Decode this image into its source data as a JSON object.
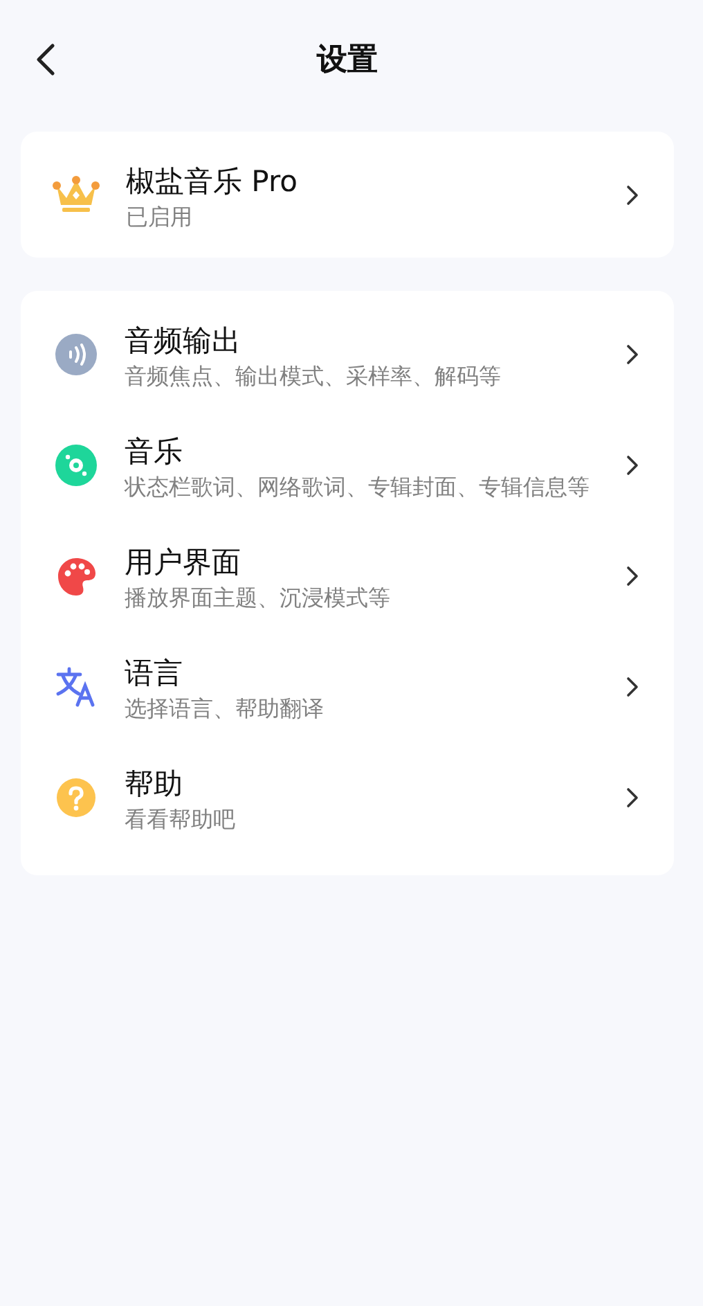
{
  "header": {
    "title": "设置"
  },
  "pro": {
    "title": "椒盐音乐 Pro",
    "subtitle": "已启用"
  },
  "items": [
    {
      "kind": "audio",
      "title": "音频输出",
      "subtitle": "音频焦点、输出模式、采样率、解码等"
    },
    {
      "kind": "music",
      "title": "音乐",
      "subtitle": "状态栏歌词、网络歌词、专辑封面、专辑信息等"
    },
    {
      "kind": "palette",
      "title": "用户界面",
      "subtitle": "播放界面主题、沉浸模式等"
    },
    {
      "kind": "translate",
      "title": "语言",
      "subtitle": "选择语言、帮助翻译"
    },
    {
      "kind": "help",
      "title": "帮助",
      "subtitle": "看看帮助吧"
    }
  ]
}
